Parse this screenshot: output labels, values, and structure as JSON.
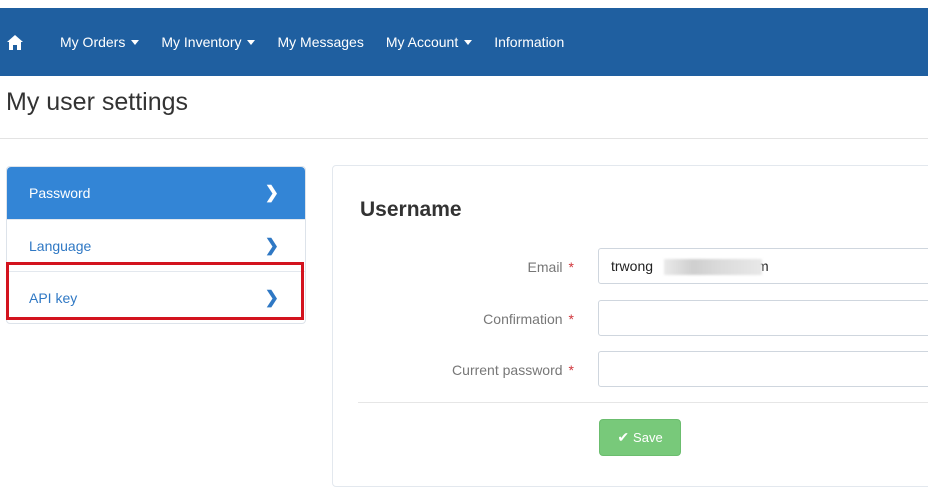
{
  "navbar": {
    "home_icon": "home-icon",
    "items": [
      {
        "label": "My Orders",
        "dropdown": true
      },
      {
        "label": "My Inventory",
        "dropdown": true
      },
      {
        "label": "My Messages",
        "dropdown": false
      },
      {
        "label": "My Account",
        "dropdown": true
      },
      {
        "label": "Information",
        "dropdown": false
      }
    ],
    "color": "#1f5fa0"
  },
  "page": {
    "title": "My user settings"
  },
  "sidebar": {
    "items": [
      {
        "label": "Password",
        "active": true
      },
      {
        "label": "Language",
        "active": false
      },
      {
        "label": "API key",
        "active": false,
        "highlighted": true
      }
    ],
    "active_color": "#3385d6",
    "highlight_color": "#d3131e"
  },
  "form": {
    "title": "Username",
    "fields": [
      {
        "label": "Email",
        "required_mark": "*",
        "value": "trwong",
        "value_tail": "m"
      },
      {
        "label": "Confirmation",
        "required_mark": "*",
        "value": ""
      },
      {
        "label": "Current password",
        "required_mark": "*",
        "value": ""
      }
    ],
    "save_label": "Save",
    "save_icon": "check-icon",
    "save_color": "#78c97a"
  }
}
